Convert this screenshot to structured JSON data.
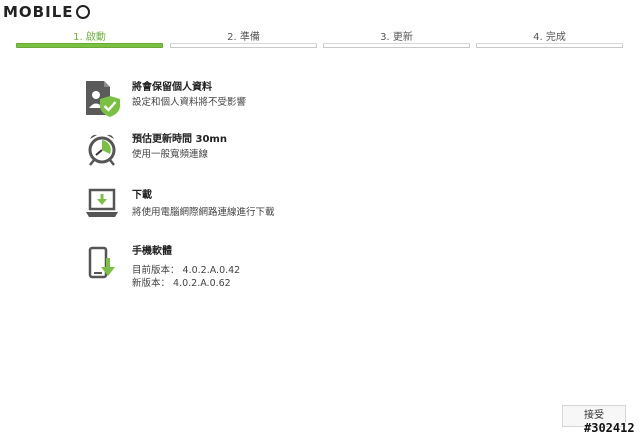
{
  "logo": {
    "text": "MOBILE"
  },
  "steps": [
    {
      "label": "1. 啟動",
      "active": true
    },
    {
      "label": "2. 準備",
      "active": false
    },
    {
      "label": "3. 更新",
      "active": false
    },
    {
      "label": "4. 完成",
      "active": false
    }
  ],
  "items": [
    {
      "icon": "user-shield-icon",
      "title": "將會保留個人資料",
      "desc": [
        "設定和個人資料將不受影響"
      ]
    },
    {
      "icon": "alarm-clock-icon",
      "title": "預估更新時間 30mn",
      "desc": [
        "使用一般寬頻連線"
      ]
    },
    {
      "icon": "laptop-download-icon",
      "title": "下載",
      "desc": [
        "將使用電腦網際網路連線進行下載"
      ]
    },
    {
      "icon": "phone-download-icon",
      "title": "手機軟體",
      "desc": [
        "目前版本： 4.0.2.A.0.42",
        "新版本： 4.0.2.A.0.62"
      ]
    }
  ],
  "accept_button": {
    "label": "接受"
  },
  "watermark": "#302412",
  "colors": {
    "accent": "#7ac143",
    "icon_dark": "#555555"
  }
}
